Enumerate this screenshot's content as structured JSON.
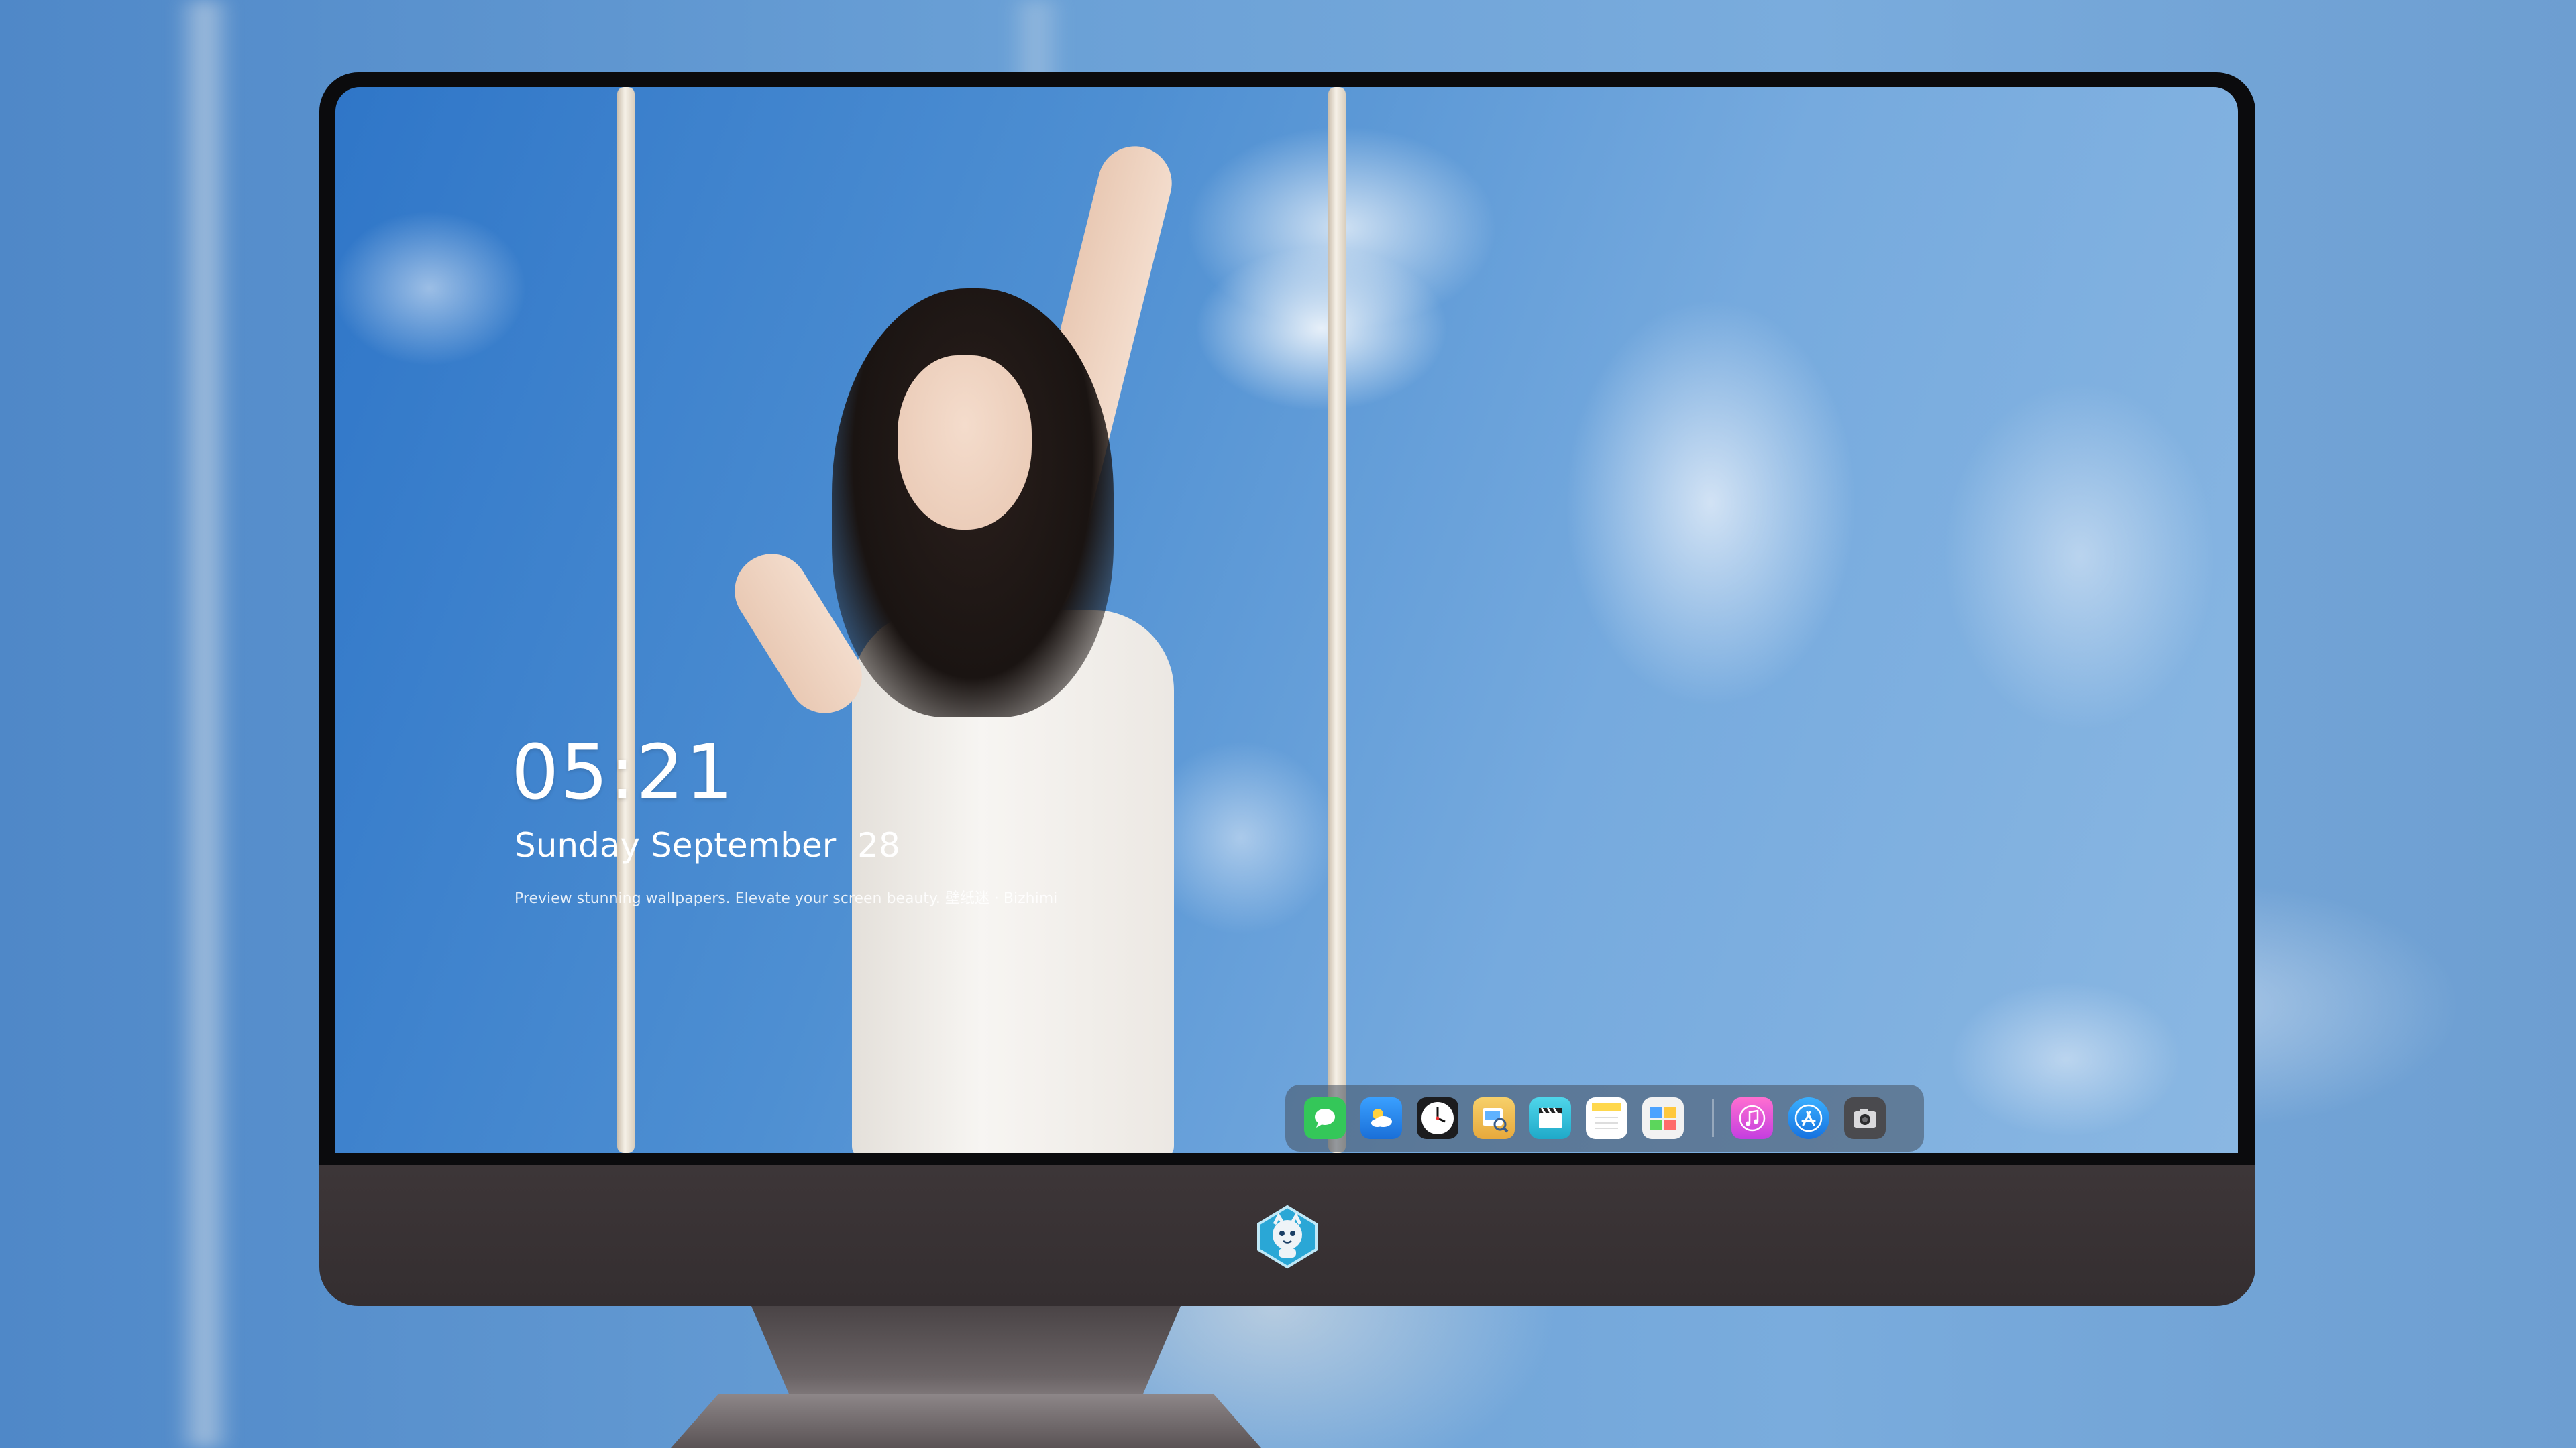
{
  "lockscreen": {
    "time": "05:21",
    "date": "Sunday September  28",
    "tagline": "Preview stunning wallpapers. Elevate your screen beauty. 壁纸迷 · Bizhimi"
  },
  "dock": {
    "apps": [
      {
        "name": "Messages",
        "icon": "messages-icon",
        "color": "#34c759"
      },
      {
        "name": "Weather",
        "icon": "weather-icon",
        "color": "#2f8ef0"
      },
      {
        "name": "Clock",
        "icon": "clock-icon",
        "color": "#ffffff"
      },
      {
        "name": "Preview",
        "icon": "preview-icon",
        "color": "#f2c14e"
      },
      {
        "name": "Clips",
        "icon": "clapperboard-icon",
        "color": "#34c4e0"
      },
      {
        "name": "Notes",
        "icon": "notes-icon",
        "color": "#ffd84d"
      },
      {
        "name": "Photo Booth",
        "icon": "photobooth-icon",
        "color": "#4da3ff"
      },
      {
        "name": "Music",
        "icon": "music-icon",
        "color": "#f04fbf"
      },
      {
        "name": "App Store",
        "icon": "appstore-icon",
        "color": "#1e90ff"
      },
      {
        "name": "Camera",
        "icon": "camera-icon",
        "color": "#5a5a5e"
      }
    ]
  },
  "monitor": {
    "logo_icon": "mascot-logo-icon",
    "bezel_color": "#0b0b0d",
    "chin_color": "#3a3335"
  }
}
